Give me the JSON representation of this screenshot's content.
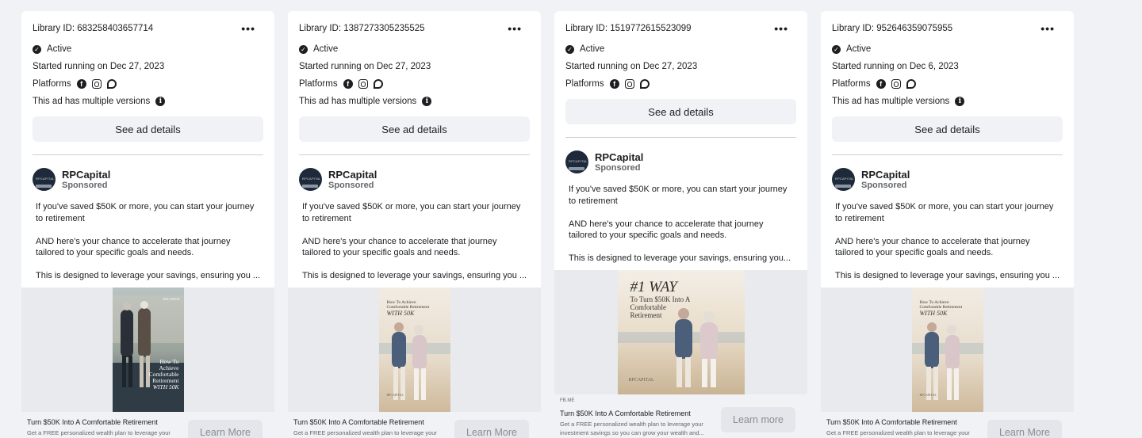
{
  "cards": [
    {
      "library_id": "Library ID: 683258403657714",
      "status": "Active",
      "started": "Started running on Dec 27, 2023",
      "platforms_label": "Platforms",
      "versions_note": "This ad has multiple versions",
      "details_button": "See ad details",
      "advertiser": "RPCapital",
      "sponsored": "Sponsored",
      "body_1": "If you've saved $50K or more, you can start your journey to retirement",
      "body_2": "AND here's your chance to accelerate that journey tailored to your specific goals and needs.",
      "body_3": "This is designed to leverage your savings, ensuring you ...",
      "creative_brand": "RPCAPITAL",
      "creative_text": [
        "How To",
        "Achieve",
        "Comfortable",
        "Retirement",
        "WITH 50K"
      ],
      "cta_title": "Turn $50K Into A Comfortable Retirement",
      "cta_desc": "Get a FREE personalized wealth plan to leverage your",
      "cta_button": "Learn More"
    },
    {
      "library_id": "Library ID: 1387273305235525",
      "status": "Active",
      "started": "Started running on Dec 27, 2023",
      "platforms_label": "Platforms",
      "versions_note": "This ad has multiple versions",
      "details_button": "See ad details",
      "advertiser": "RPCapital",
      "sponsored": "Sponsored",
      "body_1": "If you've saved $50K or more, you can start your journey to retirement",
      "body_2": "AND here's your chance to accelerate that journey tailored to your specific goals and needs.",
      "body_3": "This is designed to leverage your savings, ensuring you ...",
      "creative_text": [
        "How To Achieve",
        "Comfortable Retirement",
        "WITH 50K"
      ],
      "creative_brand": "RPCAPITAL",
      "cta_title": "Turn $50K Into A Comfortable Retirement",
      "cta_desc": "Get a FREE personalized wealth plan to leverage your",
      "cta_button": "Learn More"
    },
    {
      "library_id": "Library ID: 1519772615523099",
      "status": "Active",
      "started": "Started running on Dec 27, 2023",
      "platforms_label": "Platforms",
      "details_button": "See ad details",
      "advertiser": "RPCapital",
      "sponsored": "Sponsored",
      "body_1": "If you've saved $50K or more, you can start your journey to retirement",
      "body_2": "AND here's your chance to accelerate that journey tailored to your specific goals and needs.",
      "body_3": "This is designed to leverage your savings, ensuring you...",
      "creative_headline": "#1 WAY",
      "creative_text": [
        "To Turn $50K Into A",
        "Comfortable",
        "Retirement"
      ],
      "creative_brand": "RPCAPITAL",
      "cta_domain": "FB.ME",
      "cta_title": "Turn $50K Into A Comfortable Retirement",
      "cta_desc": "Get a FREE personalized wealth plan to leverage your",
      "cta_desc_2": "investment savings so you can grow your wealth and...",
      "cta_button": "Learn more"
    },
    {
      "library_id": "Library ID: 952646359075955",
      "status": "Active",
      "started": "Started running on Dec 6, 2023",
      "platforms_label": "Platforms",
      "versions_note": "This ad has multiple versions",
      "details_button": "See ad details",
      "advertiser": "RPCapital",
      "sponsored": "Sponsored",
      "body_1": "If you've saved $50K or more, you can start your journey to retirement",
      "body_2": "AND here's your chance to accelerate that journey tailored to your specific goals and needs.",
      "body_3": "This is designed to leverage your savings, ensuring you ...",
      "creative_text": [
        "How To Achieve",
        "Comfortable Retirement",
        "WITH 50K"
      ],
      "creative_brand": "RPCAPITAL",
      "cta_title": "Turn $50K Into A Comfortable Retirement",
      "cta_desc": "Get a FREE personalized wealth plan to leverage your",
      "cta_button": "Learn More"
    }
  ],
  "icons": {
    "more": "more-icon",
    "active": "check-circle-icon",
    "facebook": "facebook-icon",
    "instagram": "instagram-icon",
    "messenger": "messenger-icon",
    "info": "info-icon"
  },
  "colors": {
    "page_bg": "#f0f2f5",
    "card_bg": "#ffffff",
    "button_bg": "#f0f2f5",
    "muted_text": "#65676b"
  }
}
